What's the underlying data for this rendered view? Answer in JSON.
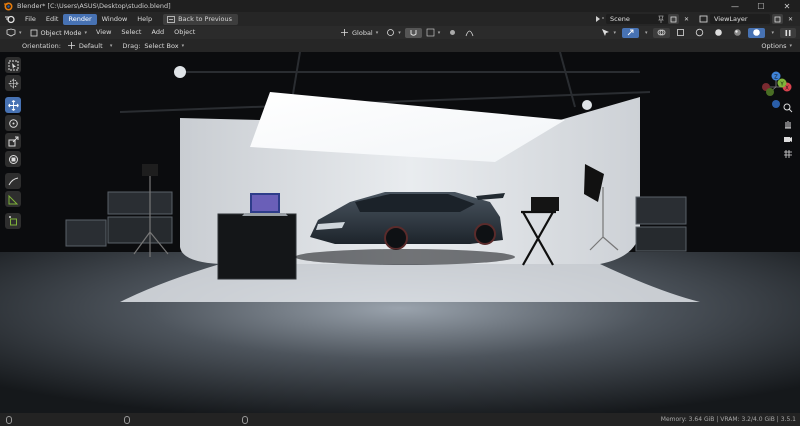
{
  "window": {
    "title": "Blender* [C:\\Users\\ASUS\\Desktop\\studio.blend]",
    "minimize": "—",
    "maximize": "☐",
    "close": "✕"
  },
  "menubar": {
    "items": [
      "File",
      "Edit",
      "Render",
      "Window",
      "Help"
    ],
    "active_index": 2,
    "back_button": "Back to Previous",
    "scene_label": "Scene",
    "view_layer_label": "ViewLayer"
  },
  "header": {
    "mode": "Object Mode",
    "menus": [
      "View",
      "Select",
      "Add",
      "Object"
    ],
    "transform_orientation": "Global"
  },
  "tool_header": {
    "orientation_label": "Orientation:",
    "orientation_value": "Default",
    "drag_label": "Drag:",
    "drag_value": "Select Box",
    "options_label": "Options"
  },
  "toolbar": {
    "tools": [
      "select-box",
      "cursor",
      "move",
      "rotate",
      "scale",
      "transform",
      "annotate",
      "measure",
      "add-cube"
    ],
    "active_index": 2
  },
  "gizmo": {
    "x_label": "X",
    "y_label": "Y",
    "z_label": "Z"
  },
  "statusbar": {
    "stats": "Memory: 3.64 GiB | VRAM: 3.2/4.0 GiB | 3.5.1"
  },
  "colors": {
    "accent": "#4772b3",
    "axis_x": "#d9434e",
    "axis_y": "#7fb33a",
    "axis_z": "#3e82d6"
  }
}
